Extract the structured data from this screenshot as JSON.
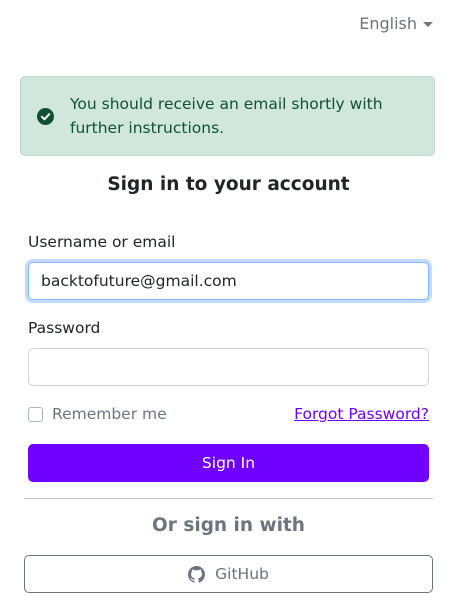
{
  "language": {
    "selected": "English",
    "icon": "chevron-down-icon"
  },
  "alert": {
    "icon": "check-circle-icon",
    "message": "You should receive an email shortly with further instructions.",
    "color": "#0f5132",
    "background": "#d1e7dd"
  },
  "form": {
    "title": "Sign in to your account",
    "username_label": "Username or email",
    "username_value": "backtofuture@gmail.com",
    "password_label": "Password",
    "password_value": "",
    "remember_label": "Remember me",
    "remember_checked": false,
    "forgot_link": "Forgot Password?",
    "submit_label": "Sign In"
  },
  "social": {
    "heading": "Or sign in with",
    "providers": [
      {
        "label": "GitHub",
        "icon": "github-icon"
      }
    ]
  },
  "colors": {
    "accent": "#6f00ff",
    "muted": "#6c757d"
  }
}
